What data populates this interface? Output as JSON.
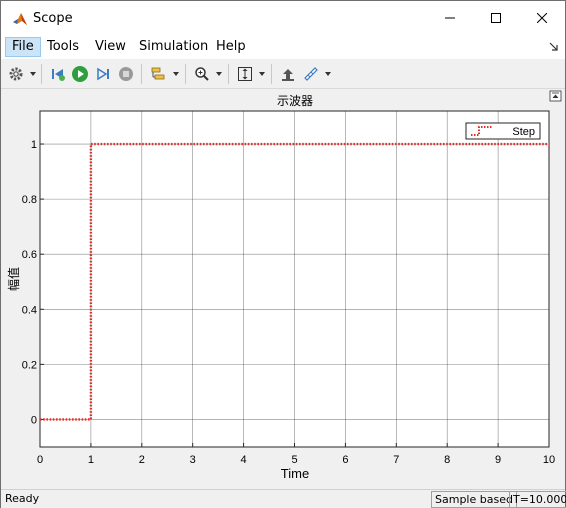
{
  "window": {
    "title": "Scope"
  },
  "menu": [
    {
      "label": "File",
      "active": true
    },
    {
      "label": "Tools"
    },
    {
      "label": "View"
    },
    {
      "label": "Simulation"
    },
    {
      "label": "Help"
    }
  ],
  "toolbar_icons": [
    "settings-icon",
    "step-back-icon",
    "run-icon",
    "step-forward-icon",
    "stop-icon",
    "style-icon",
    "zoom-icon",
    "autoscale-icon",
    "highlight-icon",
    "measure-icon"
  ],
  "status": {
    "ready": "Ready",
    "sample": "Sample based",
    "time": "T=10.000"
  },
  "colors": {
    "step_line": "#e0302a",
    "grid": "#262626",
    "plot_bg": "#ffffff"
  },
  "chart_data": {
    "type": "line",
    "title": "示波器",
    "xlabel": "Time",
    "ylabel": "幅值",
    "xlim": [
      0,
      10
    ],
    "ylim": [
      -0.1,
      1.12
    ],
    "xticks": [
      "0",
      "1",
      "2",
      "3",
      "4",
      "5",
      "6",
      "7",
      "8",
      "9",
      "10"
    ],
    "yticks": [
      "0",
      "0.2",
      "0.4",
      "0.6",
      "0.8",
      "1"
    ],
    "grid": true,
    "legend_position": "top-right",
    "series": [
      {
        "name": "Step",
        "style": "dotted",
        "x": [
          0,
          1,
          1,
          10
        ],
        "values": [
          0,
          0,
          1,
          1
        ]
      }
    ]
  }
}
